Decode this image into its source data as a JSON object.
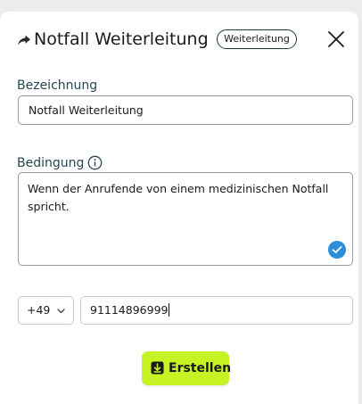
{
  "header": {
    "title": "Notfall Weiterleitung",
    "badge": "Weiterleitung"
  },
  "form": {
    "name_label": "Bezeichnung",
    "name_value": "Notfall Weiterleitung",
    "condition_label": "Bedingung",
    "condition_value": "Wenn der Anrufende von einem medizinischen Notfall spricht.",
    "country_code": "+49",
    "phone_value": "91114896999"
  },
  "actions": {
    "create_label": "Erstellen"
  },
  "icons": {
    "header": "share-arrow-icon",
    "close": "close-icon",
    "info": "info-icon",
    "check": "check-icon",
    "chevron": "chevron-down-icon",
    "create": "download-arrow-icon"
  },
  "colors": {
    "label": "#23484d",
    "accent": "#c6f323",
    "check_badge": "#2d8fd8",
    "badge_border": "#1f3a3a"
  }
}
